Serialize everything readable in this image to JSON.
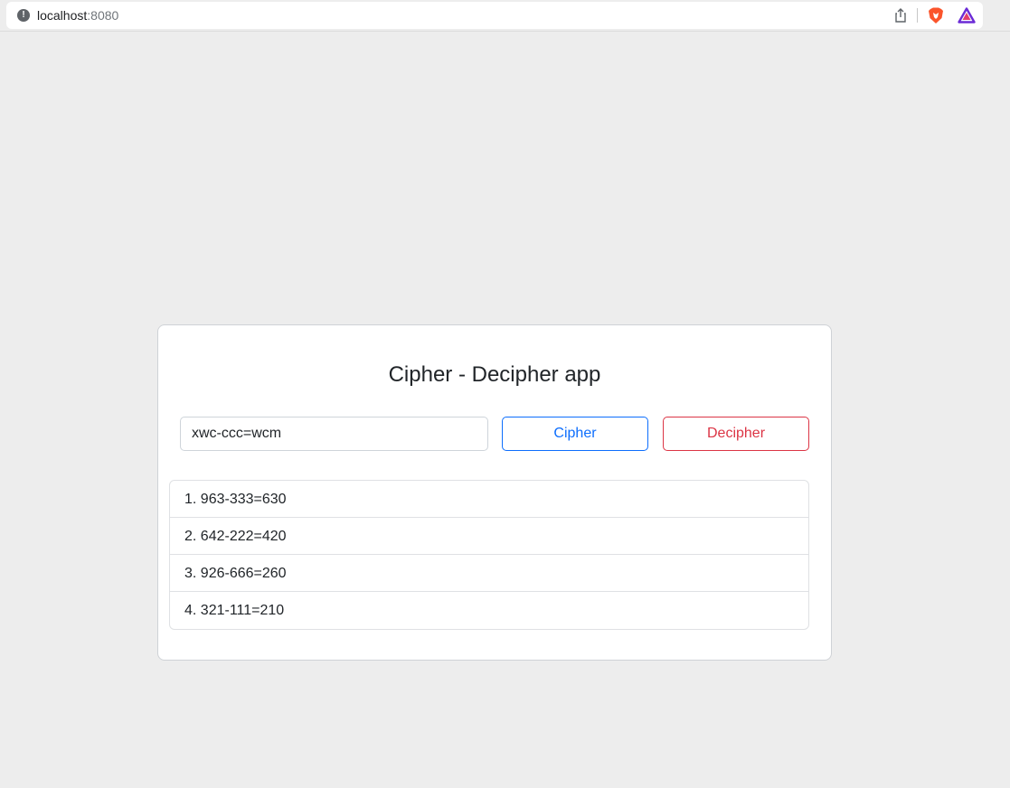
{
  "browser": {
    "host": "localhost",
    "port": ":8080",
    "icons": [
      "site-info-icon",
      "share-icon",
      "brave-shield-icon",
      "brave-rewards-icon"
    ]
  },
  "app": {
    "title": "Cipher - Decipher app",
    "input_value": "xwc-ccc=wcm",
    "cipher_label": "Cipher",
    "decipher_label": "Decipher",
    "results": [
      "1. 963-333=630",
      "2. 642-222=420",
      "3. 926-666=260",
      "4. 321-111=210"
    ]
  },
  "colors": {
    "cipher_accent": "#0d6efd",
    "decipher_accent": "#dc3545",
    "page_background": "#ededed"
  }
}
